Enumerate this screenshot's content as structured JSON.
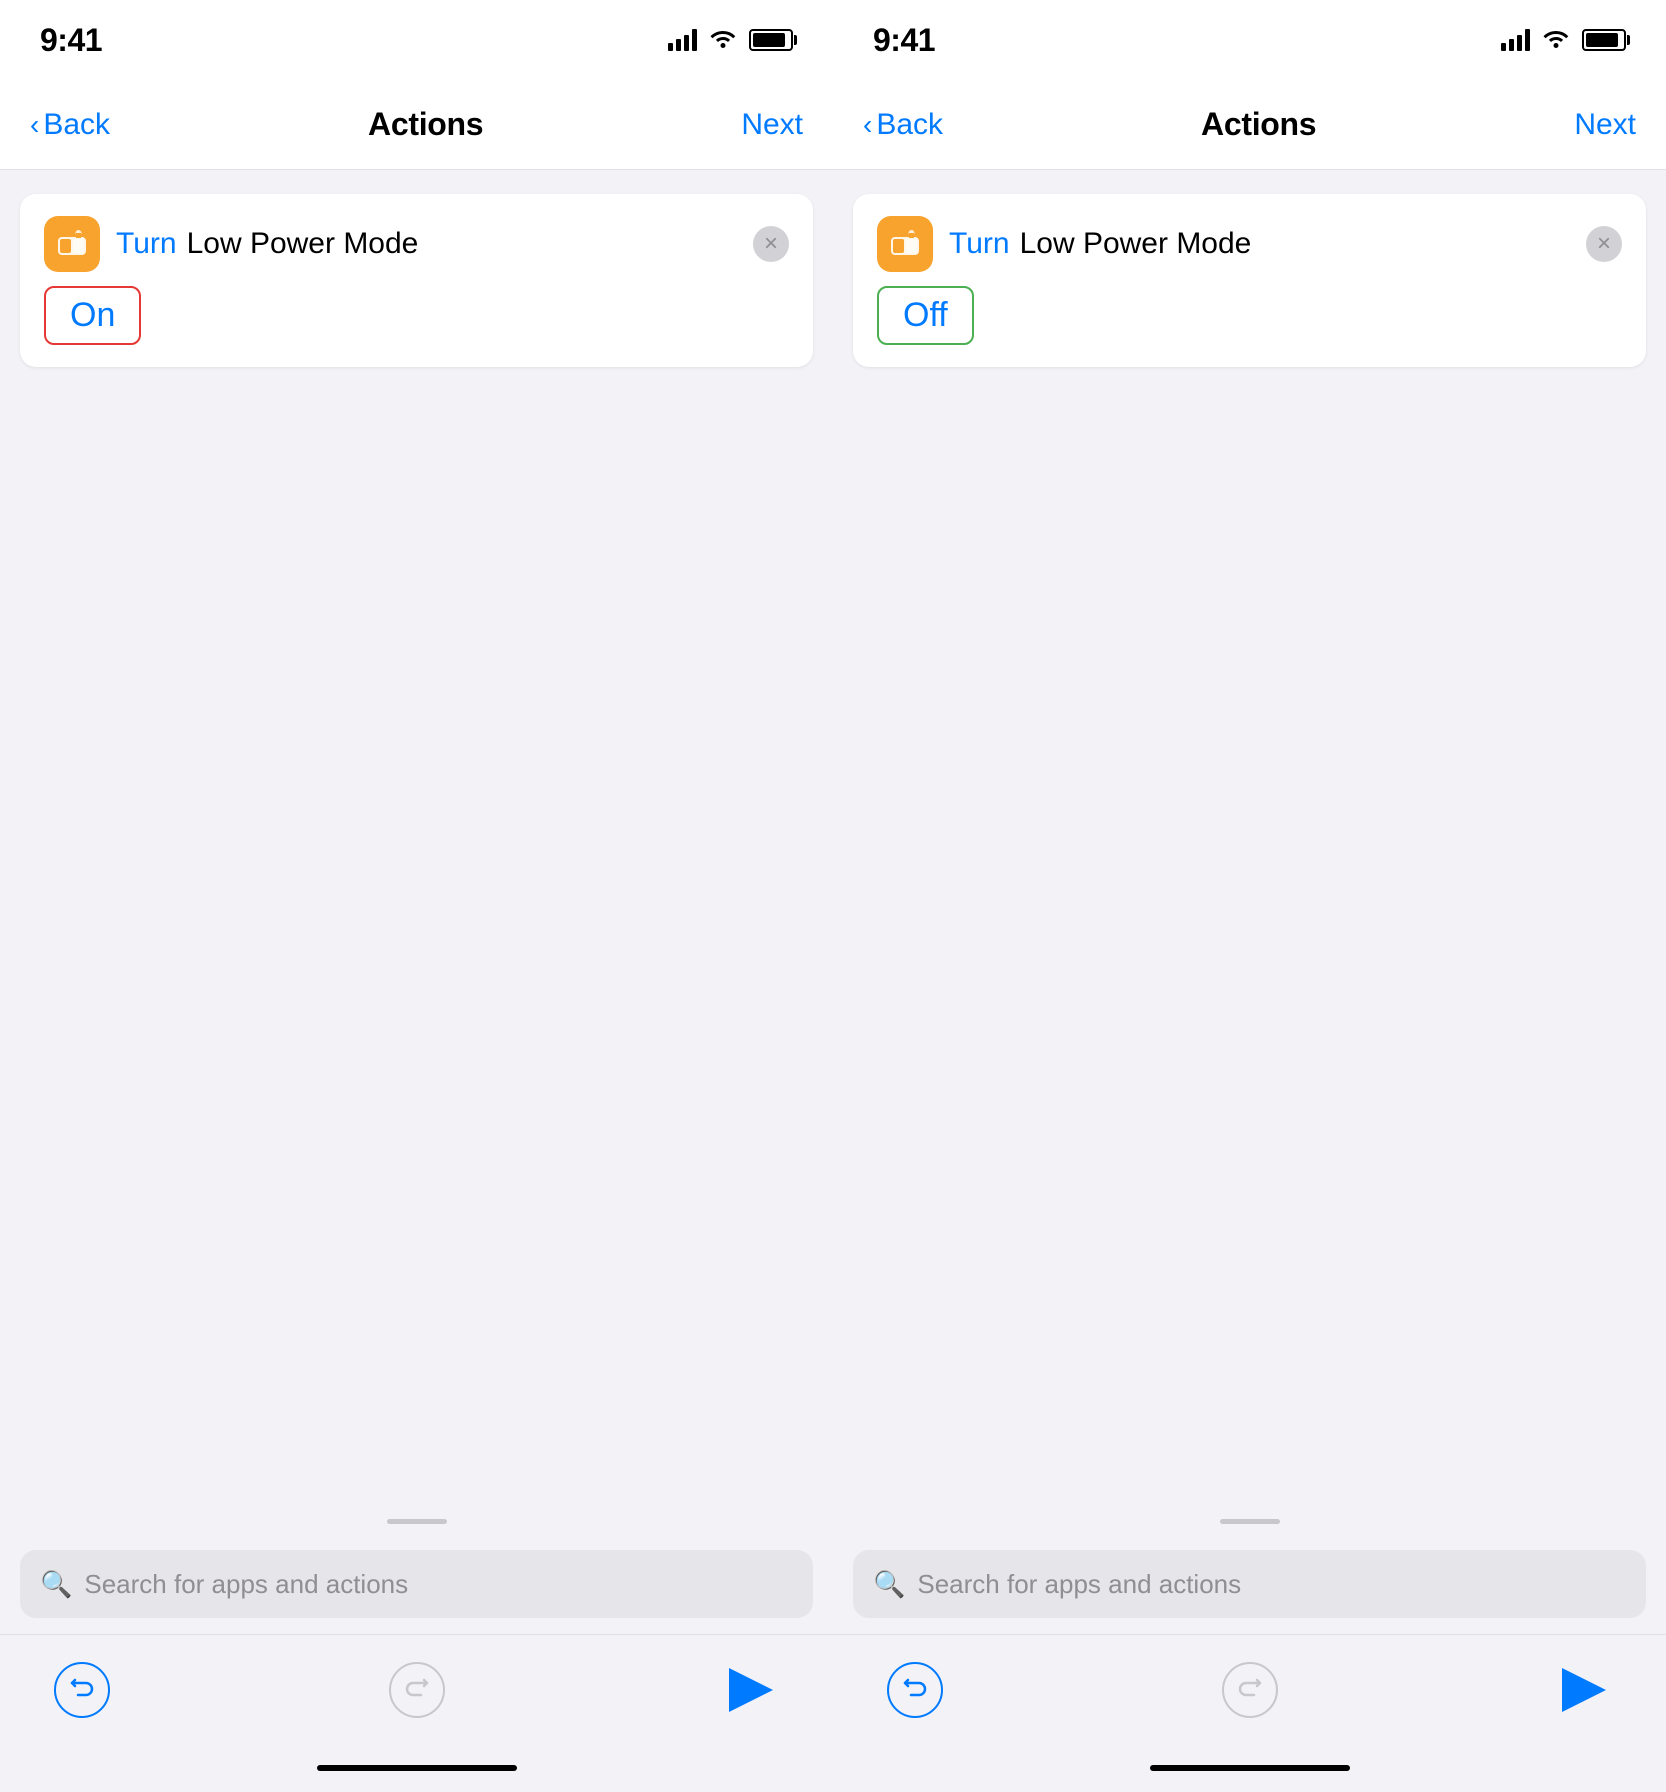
{
  "left_screen": {
    "status": {
      "time": "9:41"
    },
    "nav": {
      "back_label": "Back",
      "title": "Actions",
      "next_label": "Next"
    },
    "action_card": {
      "turn_label": "Turn",
      "mode_label": "Low Power Mode",
      "toggle_label": "On",
      "toggle_state": "on"
    },
    "search": {
      "placeholder": "Search for apps and actions"
    }
  },
  "right_screen": {
    "status": {
      "time": "9:41"
    },
    "nav": {
      "back_label": "Back",
      "title": "Actions",
      "next_label": "Next"
    },
    "action_card": {
      "turn_label": "Turn",
      "mode_label": "Low Power Mode",
      "toggle_label": "Off",
      "toggle_state": "off"
    },
    "search": {
      "placeholder": "Search for apps and actions"
    }
  },
  "icons": {
    "search": "🔍",
    "undo": "↩",
    "redo": "↪"
  },
  "colors": {
    "blue": "#007aff",
    "orange": "#f7a32e",
    "red_border": "#e53935",
    "green_border": "#4caf50",
    "gray": "#8e8e93"
  }
}
